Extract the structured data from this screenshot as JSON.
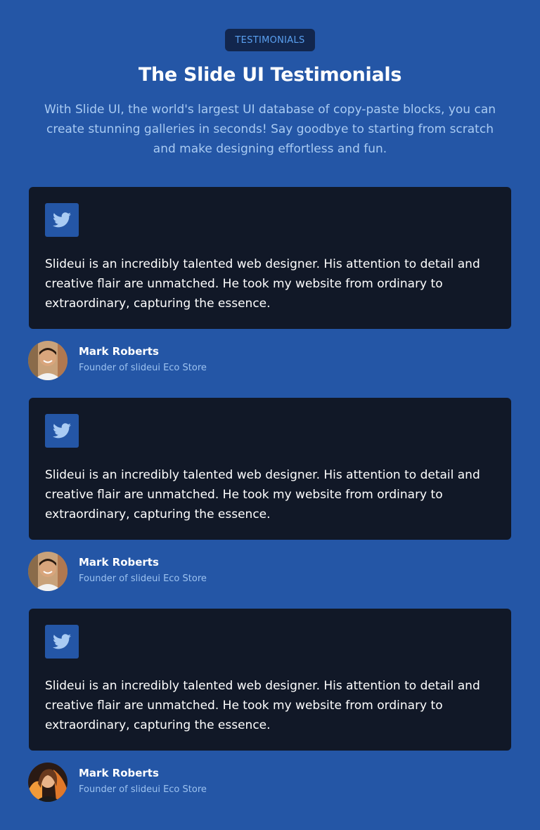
{
  "header": {
    "badge": "TESTIMONIALS",
    "title": "The Slide UI Testimonials",
    "subtitle": "With Slide UI, the world's largest UI database of copy-paste blocks, you can create stunning galleries in seconds! Say goodbye to starting from scratch and make designing effortless and fun."
  },
  "testimonials": [
    {
      "icon": "twitter-icon",
      "quote": "Slideui is an incredibly talented web designer. His attention to detail and creative flair are unmatched. He took my website from ordinary to extraordinary, capturing the essence.",
      "name": "Mark Roberts",
      "role": "Founder of slideui Eco Store"
    },
    {
      "icon": "twitter-icon",
      "quote": "Slideui is an incredibly talented web designer. His attention to detail and creative flair are unmatched. He took my website from ordinary to extraordinary, capturing the essence.",
      "name": "Mark Roberts",
      "role": "Founder of slideui Eco Store"
    },
    {
      "icon": "twitter-icon",
      "quote": "Slideui is an incredibly talented web designer. His attention to detail and creative flair are unmatched. He took my website from ordinary to extraordinary, capturing the essence.",
      "name": "Mark Roberts",
      "role": "Founder of slideui Eco Store"
    }
  ],
  "colors": {
    "page_background": "#2456a6",
    "card_background": "#111827",
    "badge_background": "#12264d",
    "badge_text": "#5aa0f0",
    "subtitle_text": "#a9cbf3",
    "twitter_icon": "#a9cbf3"
  }
}
